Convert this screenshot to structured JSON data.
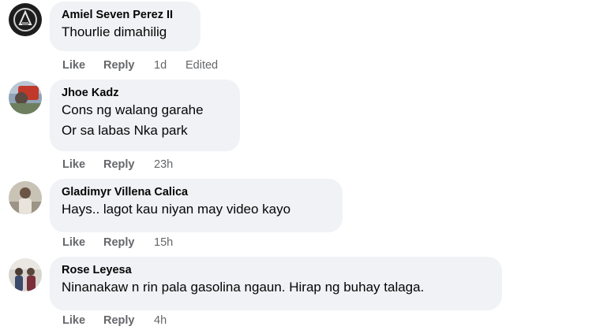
{
  "comments": [
    {
      "author": "Amiel Seven Perez II",
      "lines": [
        "Thourlie dimahilig"
      ],
      "actions": {
        "like": "Like",
        "reply": "Reply",
        "time": "1d",
        "edited": "Edited"
      }
    },
    {
      "author": "Jhoe Kadz",
      "lines": [
        "Cons ng walang garahe",
        "Or sa labas Nka park"
      ],
      "actions": {
        "like": "Like",
        "reply": "Reply",
        "time": "23h"
      }
    },
    {
      "author": "Gladimyr Villena Calica",
      "lines": [
        "Hays.. lagot kau niyan may video kayo"
      ],
      "actions": {
        "like": "Like",
        "reply": "Reply",
        "time": "15h"
      }
    },
    {
      "author": "Rose Leyesa",
      "lines": [
        "Ninanakaw n rin pala gasolina ngaun. Hirap ng buhay talaga."
      ],
      "actions": {
        "like": "Like",
        "reply": "Reply",
        "time": "4h"
      }
    }
  ],
  "colors": {
    "bubble_bg": "#f0f2f5",
    "action_text": "#65676b",
    "text": "#050505"
  }
}
